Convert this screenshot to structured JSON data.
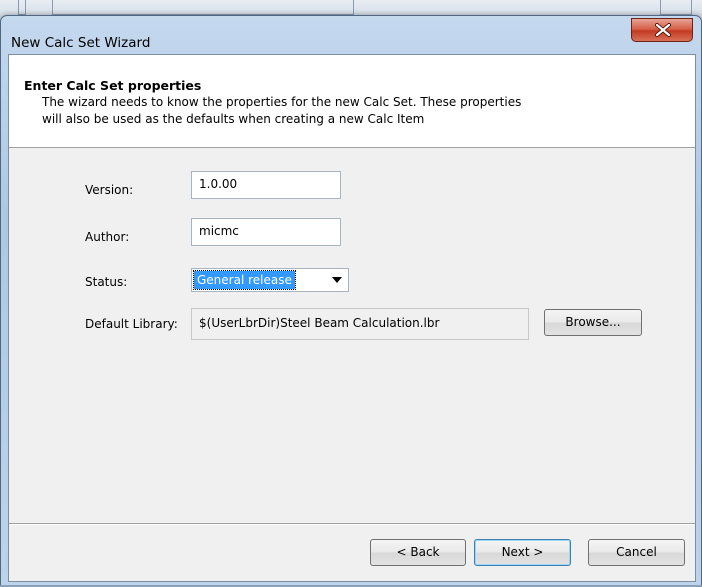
{
  "window": {
    "title": "New Calc Set Wizard",
    "close_icon": "close-x-icon"
  },
  "header": {
    "title": "Enter Calc Set properties",
    "description_line1": "The wizard needs to know the properties for the new Calc Set. These properties",
    "description_line2": "will also be used as the defaults when creating a new Calc Item"
  },
  "form": {
    "version_label": "Version:",
    "version_value": "1.0.00",
    "author_label": "Author:",
    "author_value": "micmc",
    "status_label": "Status:",
    "status_value": "General release",
    "library_label": "Default Library:",
    "library_value": "$(UserLbrDir)Steel Beam Calculation.lbr",
    "browse_label": "Browse..."
  },
  "buttons": {
    "back": "< Back",
    "next": "Next >",
    "cancel": "Cancel"
  },
  "colors": {
    "selection": "#3399ff",
    "close_button": "#c33a22",
    "title_bar": "#c4d8ee"
  }
}
